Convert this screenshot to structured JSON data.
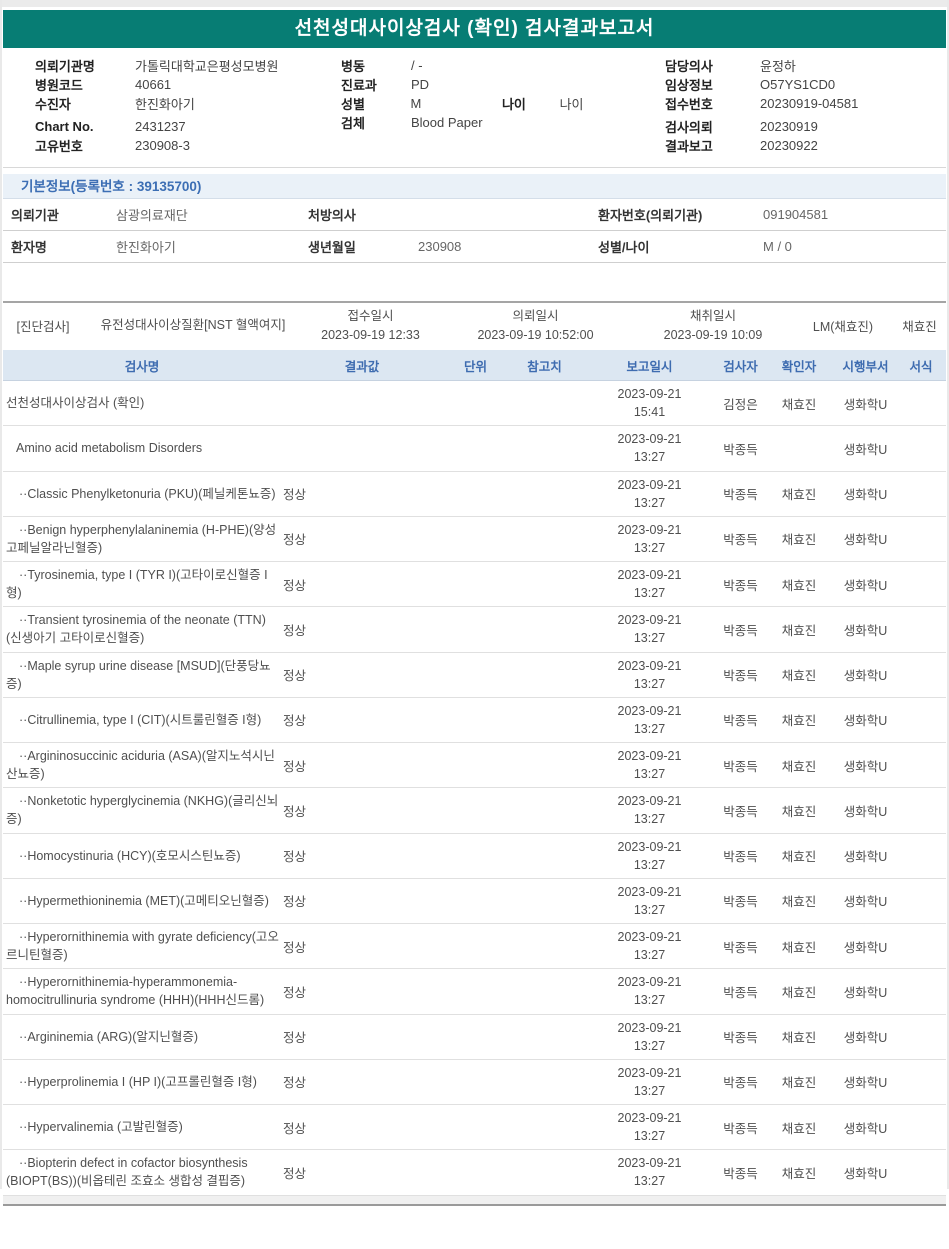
{
  "title": "선천성대사이상검사 (확인) 검사결과보고서",
  "colors": {
    "teal_header": "#077d74",
    "section_blue_text": "#3c6eb4",
    "table_header_bg": "#dce7f2",
    "table_header_text": "#3e6cb0",
    "section_header_bg": "#eaf1f8"
  },
  "patient_header": {
    "left": [
      {
        "label": "의뢰기관명",
        "value": "가톨릭대학교은평성모병원"
      },
      {
        "label": "병원코드",
        "value": "40661"
      },
      {
        "label": "수진자",
        "value": "한진화아기"
      },
      {
        "label": "Chart No.",
        "value": "2431237"
      },
      {
        "label": "고유번호",
        "value": "230908-3"
      }
    ],
    "middle": [
      {
        "label": "병동",
        "value": "/ -"
      },
      {
        "label": "진료과",
        "value": "PD"
      },
      {
        "label": "성별",
        "value": "M",
        "label2": "나이",
        "value2": "나이"
      },
      {
        "label": "검체",
        "value": "Blood Paper"
      }
    ],
    "right": [
      {
        "label": "담당의사",
        "value": "윤정하"
      },
      {
        "label": "임상정보",
        "value": "O57YS1CD0"
      },
      {
        "label": "접수번호",
        "value": "20230919-04581"
      },
      {
        "label": "검사의뢰",
        "value": "20230919"
      },
      {
        "label": "결과보고",
        "value": "20230922"
      }
    ]
  },
  "basic_info": {
    "header": "기본정보(등록번호 : 39135700)",
    "rows": [
      [
        {
          "label": "의뢰기관",
          "value": "삼광의료재단"
        },
        {
          "label": "처방의사",
          "value": ""
        },
        {
          "label": "환자번호(의뢰기관)",
          "value": "091904581"
        }
      ],
      [
        {
          "label": "환자명",
          "value": "한진화아기"
        },
        {
          "label": "생년월일",
          "value": "230908"
        },
        {
          "label": "성별/나이",
          "value": "M / 0"
        }
      ]
    ]
  },
  "diagnosis": {
    "section_label": "[진단검사]",
    "test_name": "유전성대사이상질환[NST 혈액여지]",
    "times": [
      {
        "label": "접수일시",
        "value": "2023-09-19 12:33"
      },
      {
        "label": "의뢰일시",
        "value": "2023-09-19 10:52:00"
      },
      {
        "label": "채취일시",
        "value": "2023-09-19 10:09"
      }
    ],
    "collector": "LM(채효진)",
    "collector2": "채효진"
  },
  "results": {
    "columns": [
      "검사명",
      "결과값",
      "단위",
      "참고치",
      "보고일시",
      "검사자",
      "확인자",
      "시행부서",
      "서식"
    ],
    "rows": [
      {
        "name": "선천성대사이상검사 (확인)",
        "indent": 0,
        "result": "",
        "unit": "",
        "ref": "",
        "date": "2023-09-21",
        "time": "15:41",
        "tester": "김정은",
        "confirmer": "채효진",
        "dept": "생화학U",
        "form": ""
      },
      {
        "name": "Amino acid metabolism Disorders",
        "indent": 1,
        "result": "",
        "unit": "",
        "ref": "",
        "date": "2023-09-21",
        "time": "13:27",
        "tester": "박종득",
        "confirmer": "",
        "dept": "생화학U",
        "form": ""
      },
      {
        "name": "··Classic Phenylketonuria (PKU)(페닐케톤뇨증)",
        "indent": 2,
        "result": "정상",
        "unit": "",
        "ref": "",
        "date": "2023-09-21",
        "time": "13:27",
        "tester": "박종득",
        "confirmer": "채효진",
        "dept": "생화학U",
        "form": ""
      },
      {
        "name": "··Benign hyperphenylalaninemia (H-PHE)(양성 고페닐알라닌혈증)",
        "indent": 2,
        "result": "정상",
        "unit": "",
        "ref": "",
        "date": "2023-09-21",
        "time": "13:27",
        "tester": "박종득",
        "confirmer": "채효진",
        "dept": "생화학U",
        "form": ""
      },
      {
        "name": "··Tyrosinemia, type I (TYR I)(고타이로신혈증 I형)",
        "indent": 2,
        "result": "정상",
        "unit": "",
        "ref": "",
        "date": "2023-09-21",
        "time": "13:27",
        "tester": "박종득",
        "confirmer": "채효진",
        "dept": "생화학U",
        "form": ""
      },
      {
        "name": "··Transient tyrosinemia of the neonate (TTN)(신생아기 고타이로신혈증)",
        "indent": 2,
        "result": "정상",
        "unit": "",
        "ref": "",
        "date": "2023-09-21",
        "time": "13:27",
        "tester": "박종득",
        "confirmer": "채효진",
        "dept": "생화학U",
        "form": ""
      },
      {
        "name": "··Maple syrup urine disease [MSUD](단풍당뇨증)",
        "indent": 2,
        "result": "정상",
        "unit": "",
        "ref": "",
        "date": "2023-09-21",
        "time": "13:27",
        "tester": "박종득",
        "confirmer": "채효진",
        "dept": "생화학U",
        "form": ""
      },
      {
        "name": "··Citrullinemia, type I (CIT)(시트룰린혈증 I형)",
        "indent": 2,
        "result": "정상",
        "unit": "",
        "ref": "",
        "date": "2023-09-21",
        "time": "13:27",
        "tester": "박종득",
        "confirmer": "채효진",
        "dept": "생화학U",
        "form": ""
      },
      {
        "name": "··Argininosuccinic aciduria (ASA)(알지노석시닌산뇨증)",
        "indent": 2,
        "result": "정상",
        "unit": "",
        "ref": "",
        "date": "2023-09-21",
        "time": "13:27",
        "tester": "박종득",
        "confirmer": "채효진",
        "dept": "생화학U",
        "form": ""
      },
      {
        "name": "··Nonketotic hyperglycinemia (NKHG)(글리신뇌증)",
        "indent": 2,
        "result": "정상",
        "unit": "",
        "ref": "",
        "date": "2023-09-21",
        "time": "13:27",
        "tester": "박종득",
        "confirmer": "채효진",
        "dept": "생화학U",
        "form": ""
      },
      {
        "name": "··Homocystinuria (HCY)(호모시스틴뇨증)",
        "indent": 2,
        "result": "정상",
        "unit": "",
        "ref": "",
        "date": "2023-09-21",
        "time": "13:27",
        "tester": "박종득",
        "confirmer": "채효진",
        "dept": "생화학U",
        "form": ""
      },
      {
        "name": "··Hypermethioninemia (MET)(고메티오닌혈증)",
        "indent": 2,
        "result": "정상",
        "unit": "",
        "ref": "",
        "date": "2023-09-21",
        "time": "13:27",
        "tester": "박종득",
        "confirmer": "채효진",
        "dept": "생화학U",
        "form": ""
      },
      {
        "name": "··Hyperornithinemia with gyrate deficiency(고오르니틴혈증)",
        "indent": 2,
        "result": "정상",
        "unit": "",
        "ref": "",
        "date": "2023-09-21",
        "time": "13:27",
        "tester": "박종득",
        "confirmer": "채효진",
        "dept": "생화학U",
        "form": ""
      },
      {
        "name": "··Hyperornithinemia-hyperammonemia-homocitrullinuria syndrome (HHH)(HHH신드롬)",
        "indent": 2,
        "result": "정상",
        "unit": "",
        "ref": "",
        "date": "2023-09-21",
        "time": "13:27",
        "tester": "박종득",
        "confirmer": "채효진",
        "dept": "생화학U",
        "form": ""
      },
      {
        "name": "··Argininemia (ARG)(알지닌혈증)",
        "indent": 2,
        "result": "정상",
        "unit": "",
        "ref": "",
        "date": "2023-09-21",
        "time": "13:27",
        "tester": "박종득",
        "confirmer": "채효진",
        "dept": "생화학U",
        "form": ""
      },
      {
        "name": "··Hyperprolinemia I (HP I)(고프롤린혈증 I형)",
        "indent": 2,
        "result": "정상",
        "unit": "",
        "ref": "",
        "date": "2023-09-21",
        "time": "13:27",
        "tester": "박종득",
        "confirmer": "채효진",
        "dept": "생화학U",
        "form": ""
      },
      {
        "name": "··Hypervalinemia (고발린혈증)",
        "indent": 2,
        "result": "정상",
        "unit": "",
        "ref": "",
        "date": "2023-09-21",
        "time": "13:27",
        "tester": "박종득",
        "confirmer": "채효진",
        "dept": "생화학U",
        "form": ""
      },
      {
        "name": "··Biopterin defect in cofactor biosynthesis (BIOPT(BS))(비옵테린 조효소 생합성 결핍증)",
        "indent": 2,
        "result": "정상",
        "unit": "",
        "ref": "",
        "date": "2023-09-21",
        "time": "13:27",
        "tester": "박종득",
        "confirmer": "채효진",
        "dept": "생화학U",
        "form": ""
      }
    ]
  }
}
